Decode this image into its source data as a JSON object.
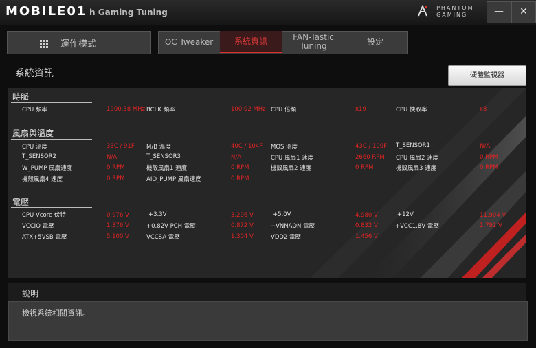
{
  "titlebar": {
    "watermark": "MOBILE01",
    "app_title": "h Gaming Tuning",
    "brand_line1": "PHANTOM",
    "brand_line2": "GAMING",
    "minimize": "—",
    "close": "✕"
  },
  "nav": {
    "operation_mode": "運作模式",
    "tabs": [
      "OC Tweaker",
      "系統資訊",
      "FAN-Tastic Tuning",
      "設定"
    ],
    "active_tab": "系統資訊"
  },
  "page": {
    "title": "系統資訊",
    "hw_monitor_button": "硬體監視器"
  },
  "sections": {
    "clock": {
      "title": "時脈",
      "rows": [
        [
          [
            "CPU 頻率",
            "1900.38 MHz"
          ],
          [
            "BCLK 頻率",
            "100.02 MHz"
          ],
          [
            "CPU 倍頻",
            "x19"
          ],
          [
            "CPU 快取率",
            "x8"
          ]
        ]
      ]
    },
    "fan_temp": {
      "title": "風扇與溫度",
      "rows": [
        [
          [
            "CPU 溫度",
            "33C / 91F"
          ],
          [
            "M/B 溫度",
            "40C / 104F"
          ],
          [
            "MOS 溫度",
            "43C / 109F"
          ],
          [
            "T_SENSOR1",
            "N/A"
          ]
        ],
        [
          [
            "T_SENSOR2",
            "N/A"
          ],
          [
            "T_SENSOR3",
            "N/A"
          ],
          [
            "CPU 風扇1 速度",
            "2660 RPM"
          ],
          [
            "CPU 風扇2 速度",
            "0 RPM"
          ]
        ],
        [
          [
            "W_PUMP 風扇速度",
            "0 RPM"
          ],
          [
            "機殼風扇1 速度",
            "0 RPM"
          ],
          [
            "機殼風扇2 速度",
            "0 RPM"
          ],
          [
            "機殼風扇3 速度",
            "0 RPM"
          ]
        ],
        [
          [
            "機殼風扇4 速度",
            "0 RPM"
          ],
          [
            "AIO_PUMP 風扇速度",
            "0 RPM"
          ]
        ]
      ]
    },
    "voltage": {
      "title": "電壓",
      "rows": [
        [
          [
            "CPU Vcore 伏特",
            "0.976 V"
          ],
          [
            "+3.3V",
            "3.296 V"
          ],
          [
            "+5.0V",
            "4.980 V"
          ],
          [
            "+12V",
            "11.904 V"
          ]
        ],
        [
          [
            "VCCIO 電壓",
            "1.376 V"
          ],
          [
            "+0.82V PCH 電壓",
            "0.872 V"
          ],
          [
            "+VNNAON 電壓",
            "0.832 V"
          ],
          [
            "+VCC1.8V 電壓",
            "1.792 V"
          ]
        ],
        [
          [
            "ATX+5VSB 電壓",
            "5.100 V"
          ],
          [
            "VCCSA 電壓",
            "1.304 V"
          ],
          [
            "VDD2 電壓",
            "1.456 V"
          ]
        ]
      ]
    }
  },
  "description": {
    "title": "說明",
    "text": "檢視系統相關資訊。"
  },
  "colors": {
    "accent_red": "#e22424",
    "panel": "#262626"
  }
}
